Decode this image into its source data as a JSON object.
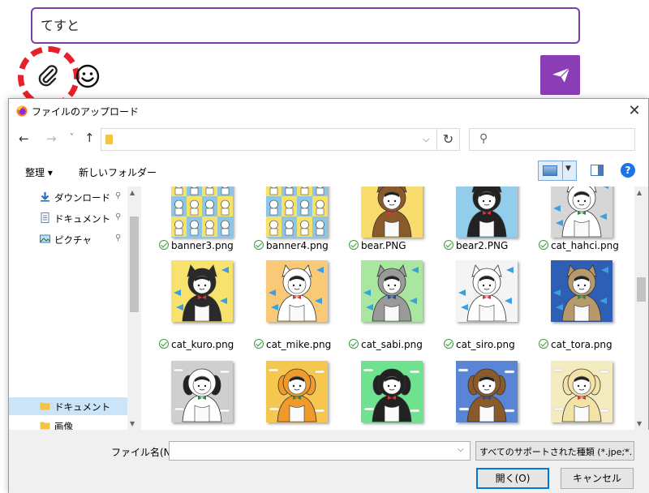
{
  "chat": {
    "input_value": "てすと",
    "icons": {
      "attach": "paperclip-icon",
      "emoji": "smiley-icon",
      "send": "paper-plane-icon"
    },
    "colors": {
      "accent": "#8a3db5",
      "input_border": "#7b3fa8",
      "highlight_ring": "#e8202a"
    }
  },
  "dialog": {
    "title": "ファイルのアップロード",
    "close_glyph": "✕",
    "nav": {
      "back_glyph": "←",
      "forward_glyph": "→",
      "recent_glyph": "˅",
      "up_glyph": "↑",
      "address_value": "",
      "dropdown_glyph": "⌵",
      "refresh_glyph": "↻",
      "search_glyph": "⚲",
      "search_placeholder": ""
    },
    "commands": {
      "organize_label": "整理 ▾",
      "new_folder_label": "新しいフォルダー",
      "help_glyph": "?"
    },
    "tree": {
      "items": [
        {
          "label": "ダウンロード",
          "icon": "download-icon",
          "pin": "📌"
        },
        {
          "label": "ドキュメント",
          "icon": "document-icon",
          "pin": "📌"
        },
        {
          "label": "ピクチャ",
          "icon": "pictures-icon",
          "pin": "📌"
        },
        {
          "label": "ドキュメント",
          "icon": "folder-icon",
          "pin": ""
        },
        {
          "label": "画像",
          "icon": "folder-icon",
          "pin": ""
        }
      ],
      "selected_index": 3
    },
    "files": [
      {
        "name": "banner3.png",
        "bg": "#8ec7e6",
        "kind": "banner"
      },
      {
        "name": "banner4.png",
        "bg": "#8ec7e6",
        "kind": "banner"
      },
      {
        "name": "bear.PNG",
        "bg": "#f9dc6e",
        "kind": "bear"
      },
      {
        "name": "bear2.PNG",
        "bg": "#93cde9",
        "kind": "bear2"
      },
      {
        "name": "cat_hahci.png",
        "bg": "#d6d6d6",
        "kind": "cat_gray_bg"
      },
      {
        "name": "cat_kuro.png",
        "bg": "#f7e26d",
        "kind": "cat_black"
      },
      {
        "name": "cat_mike.png",
        "bg": "#f8c976",
        "kind": "cat_calico"
      },
      {
        "name": "cat_sabi.png",
        "bg": "#a9e69f",
        "kind": "cat_gray"
      },
      {
        "name": "cat_siro.png",
        "bg": "#f4f4f4",
        "kind": "cat_white"
      },
      {
        "name": "cat_tora.png",
        "bg": "#2e5fb5",
        "kind": "cat_tabby"
      },
      {
        "name": "",
        "bg": "#cfcfcf",
        "kind": "dog_dalmatian"
      },
      {
        "name": "",
        "bg": "#f6c74e",
        "kind": "dog_orange"
      },
      {
        "name": "",
        "bg": "#6fe28f",
        "kind": "dog_black"
      },
      {
        "name": "",
        "bg": "#5a84d6",
        "kind": "dog_brown"
      },
      {
        "name": "",
        "bg": "#f4ebbe",
        "kind": "dog_cream"
      }
    ],
    "bottom": {
      "file_name_label": "ファイル名(N):",
      "file_name_value": "",
      "file_type_value": "すべてのサポートされた種類 (*.jpe;*.",
      "open_label": "開く(O)",
      "cancel_label": "キャンセル"
    }
  }
}
